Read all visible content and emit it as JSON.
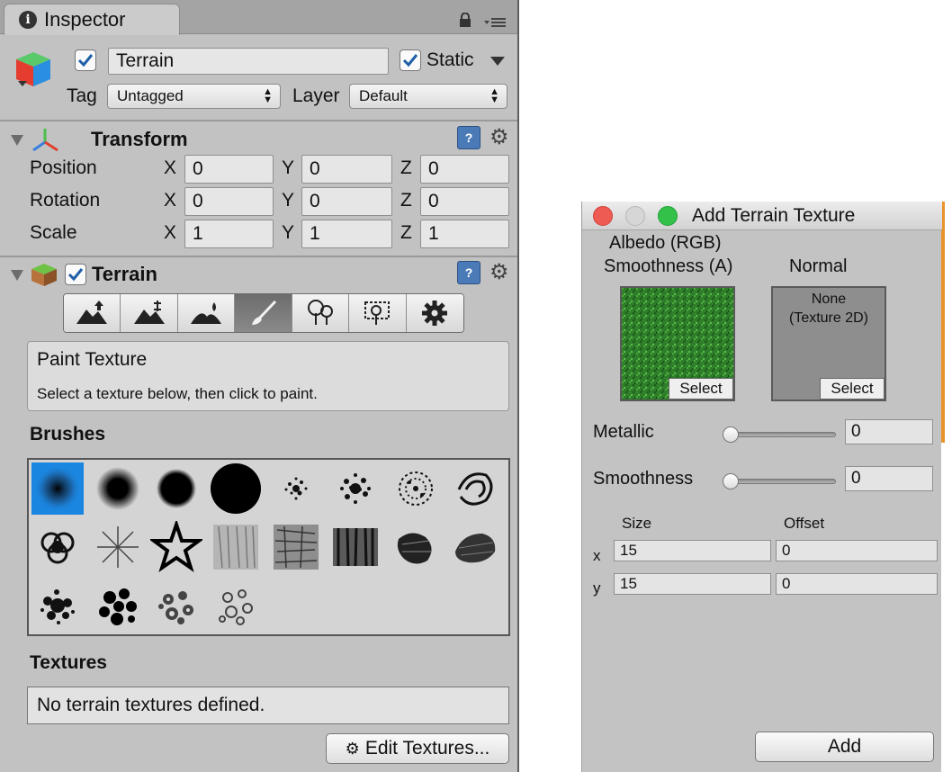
{
  "inspector": {
    "tab_label": "Inspector",
    "object": {
      "name": "Terrain",
      "enabled": true,
      "static_label": "Static",
      "static_checked": true,
      "tag_label": "Tag",
      "tag_value": "Untagged",
      "layer_label": "Layer",
      "layer_value": "Default"
    },
    "transform": {
      "title": "Transform",
      "rows": [
        {
          "label": "Position",
          "x": "0",
          "y": "0",
          "z": "0"
        },
        {
          "label": "Rotation",
          "x": "0",
          "y": "0",
          "z": "0"
        },
        {
          "label": "Scale",
          "x": "1",
          "y": "1",
          "z": "1"
        }
      ],
      "axis_x": "X",
      "axis_y": "Y",
      "axis_z": "Z"
    },
    "terrain": {
      "title": "Terrain",
      "enabled": true,
      "tools": [
        "raise-lower-icon",
        "paint-height-icon",
        "smooth-height-icon",
        "paint-texture-icon",
        "place-trees-icon",
        "paint-details-icon",
        "terrain-settings-icon"
      ],
      "active_tool_index": 3,
      "paint_title": "Paint Texture",
      "paint_hint": "Select a texture below, then click to paint.",
      "brushes_label": "Brushes",
      "brush_count": 20,
      "selected_brush_index": 0,
      "textures_label": "Textures",
      "no_textures_text": "No terrain textures defined.",
      "edit_textures_label": "Edit Textures..."
    }
  },
  "dialog": {
    "title": "Add Terrain Texture",
    "albedo_label_1": "Albedo (RGB)",
    "albedo_label_2": "Smoothness (A)",
    "normal_label": "Normal",
    "normal_none_1": "None",
    "normal_none_2": "(Texture 2D)",
    "select_label": "Select",
    "metallic_label": "Metallic",
    "metallic_value": "0",
    "smoothness_label": "Smoothness",
    "smoothness_value": "0",
    "size_label": "Size",
    "offset_label": "Offset",
    "x_label": "x",
    "y_label": "y",
    "size_x": "15",
    "size_y": "15",
    "offset_x": "0",
    "offset_y": "0",
    "add_label": "Add"
  }
}
